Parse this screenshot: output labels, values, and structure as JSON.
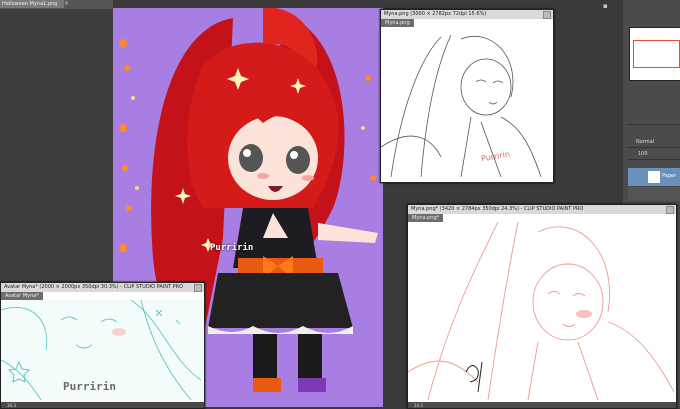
{
  "main_window": {
    "tab_label": "Halloween Myna1.png",
    "close_label": "×"
  },
  "window_sketch": {
    "title": "Myna.png (3000 × 2782px 72dpi 15.6%)",
    "tab_label": "Myna.png",
    "signature": "Purririn"
  },
  "window_pink": {
    "title": "Myna.png* (3420 × 2784px 350dpi 24.3%) - CLIP STUDIO PAINT PRO",
    "tab_label": "Myna.png*",
    "zoom": "24.3"
  },
  "window_teal": {
    "title": "Avatar Myna* (2000 × 2000px 350dpi 30.3%) - CLIP STUDIO PAINT PRO",
    "tab_label": "Avatar Myna*",
    "signature": "Purririn",
    "zoom": "30.3"
  },
  "artwork": {
    "signature": "Purririn"
  },
  "layer_panel": {
    "blend_mode": "Normal",
    "opacity": "100",
    "layer_name": "Paper"
  },
  "colors": {
    "app_bg": "#3a3a3a",
    "panel_bg": "#4b4b4b",
    "canvas_purple": "#a97ee3",
    "hair_red": "#d51a1a",
    "teal_line": "#5cc9bd",
    "pink_line": "#ee9a92"
  }
}
